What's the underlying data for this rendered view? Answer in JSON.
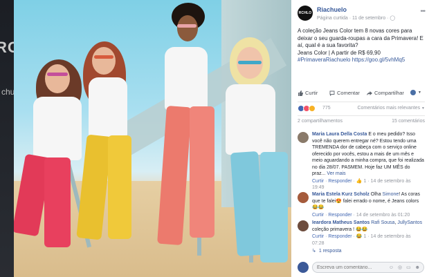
{
  "post": {
    "page_name": "Riachuelo",
    "avatar_text": "RCHLO",
    "meta": "Página curtida · 11 de setembro · ",
    "text_lines": [
      "A coleção Jeans Color tem 8 novas cores para deixar o seu guarda-roupas a cara da Primavera! E aí, qual é a sua favorita?",
      "Jeans Color | A partir de R$ 69,90"
    ],
    "hashtag": "#PrimaveraRiachuelo",
    "link": "https://goo.gl/5vhMq5"
  },
  "photo": {
    "blur_text": "RO",
    "blur_side": "chuelo"
  },
  "actions": {
    "like": "Curtir",
    "comment": "Comentar",
    "share": "Compartilhar"
  },
  "reactions": {
    "count": "775",
    "sort": "Comentários mais relevantes"
  },
  "shares": {
    "label": "2 compartilhamentos",
    "comments": "15 comentários"
  },
  "comments": [
    {
      "author": "Maria Laura Della Costa",
      "text": " E o meu pedido? Isso você não querem entregar né? Estou tendo uma TREMENDA dor de cabeça com o serviço online oferecido por vocês, estou a mais de um mês e meio aguardando a minha compra, que foi realizada no dia 28/07. PASMEM. Hoje faz UM MÊS do praz...",
      "more": "Ver mais",
      "meta_like": "Curtir",
      "meta_reply": "Responder",
      "meta_rest": " · 👍 1 · 14 de setembro às 19:49",
      "avatar_color": "#8a7a6a"
    },
    {
      "author": "Maria Estela Kurz Scholz",
      "text": " Olha ",
      "mention": "Simone",
      "text2": "! As coras que te falei😍 falei errado o nome, é Jeans colors 😂😂",
      "meta_like": "Curtir",
      "meta_reply": "Responder",
      "meta_rest": " · 14 de setembro às 01:20",
      "avatar_color": "#a55b3c"
    },
    {
      "author": "Ieardora Matheus Santos",
      "mention": "Rafi Sousa",
      "mention2": "JullySantos",
      "text": " coleção primavera ! 😂😂",
      "meta_like": "Curtir",
      "meta_reply": "Responder",
      "meta_rest": " · 😂 1 · 14 de setembro às 07:28",
      "avatar_color": "#6d4c3d"
    }
  ],
  "replies": "1 resposta",
  "write_placeholder": "Escreva um comentário...",
  "colors": {
    "link": "#365899",
    "muted": "#90949c",
    "like": "#4267b2",
    "love": "#f25268",
    "haha": "#f7b125"
  }
}
